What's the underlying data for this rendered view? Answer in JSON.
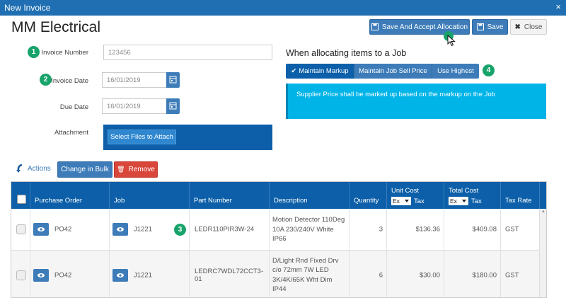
{
  "window": {
    "title": "New Invoice",
    "close_glyph": "×"
  },
  "company": "MM Electrical",
  "toolbar": {
    "save_accept_label": "Save And Accept Allocation",
    "save_label": "Save",
    "close_label": "Close"
  },
  "form": {
    "invoice_number_label": "Invoice Number",
    "invoice_number_value": "123456",
    "invoice_date_label": "Invoice Date",
    "invoice_date_value": "16/01/2019",
    "due_date_label": "Due Date",
    "due_date_value": "16/01/2019",
    "attachment_label": "Attachment",
    "attach_button": "Select Files to Attach"
  },
  "allocation": {
    "title": "When allocating items to a Job",
    "options": [
      "Maintain Markup",
      "Maintain Job Sell Price",
      "Use Highest"
    ],
    "selected": "Maintain Markup",
    "info": "Supplier Price shall be marked up based on the markup on the Job"
  },
  "steps": [
    "1",
    "2",
    "3",
    "4"
  ],
  "bulk": {
    "actions_label": "Actions",
    "change_bulk_label": "Change in Bulk",
    "remove_label": "Remove"
  },
  "table": {
    "headers": {
      "purchase_order": "Purchase Order",
      "job": "Job",
      "part_number": "Part Number",
      "description": "Description",
      "quantity": "Quantity",
      "unit_cost": "Unit Cost",
      "total_cost": "Total Cost",
      "tax_rate": "Tax Rate"
    },
    "tax_select": "Ex",
    "tax_label": "Tax",
    "rows": [
      {
        "po": "PO42",
        "job": "J1221",
        "part": "LEDR110PIR3W-24",
        "desc": "Motion Detector 110Deg 10A 230/240V White IP66",
        "qty": "3",
        "unit": "$136.36",
        "total": "$409.08",
        "tax": "GST"
      },
      {
        "po": "PO42",
        "job": "J1221",
        "part": "LEDRC7WDL72CCT3-01",
        "desc": "D/Light Rnd Fixed Drv c/o 72mm 7W LED 3K/4K/65K Wht Dim IP44",
        "qty": "6",
        "unit": "$30.00",
        "total": "$180.00",
        "tax": "GST"
      }
    ]
  },
  "colors": {
    "header_blue": "#1f6fb2",
    "grid_header": "#0c5fa8",
    "button_blue": "#3d7cb8",
    "step_green": "#18a36b",
    "info_cyan": "#00b4e8",
    "remove_red": "#d9463a"
  },
  "icons": [
    "floppy-disk-icon",
    "close-x-icon",
    "calendar-icon",
    "check-icon",
    "undo-arrow-icon",
    "trash-icon",
    "eye-icon",
    "mouse-pointer-icon"
  ]
}
